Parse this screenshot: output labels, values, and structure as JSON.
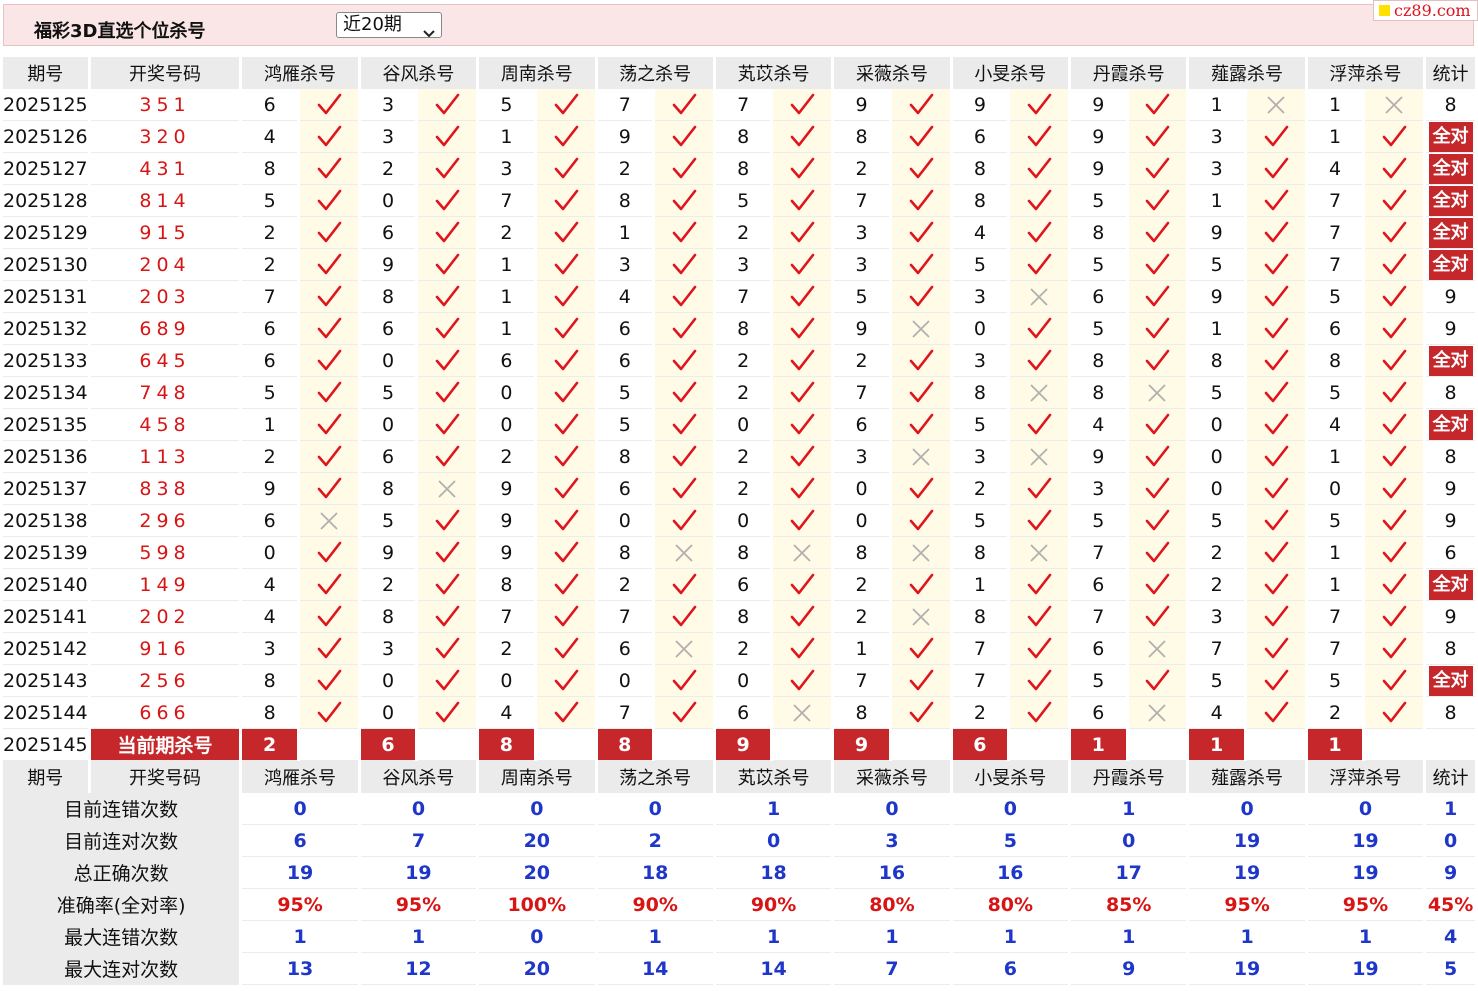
{
  "header": {
    "title": "福彩3D直选个位杀号",
    "period_select": "近20期",
    "watermark": "cz89.com"
  },
  "columns": {
    "period": "期号",
    "draw": "开奖号码",
    "experts": [
      "鸿雁杀号",
      "谷风杀号",
      "周南杀号",
      "荡之杀号",
      "芄苡杀号",
      "采薇杀号",
      "小旻杀号",
      "丹霞杀号",
      "薤露杀号",
      "浮萍杀号"
    ],
    "stats": "统计"
  },
  "all_right_label": "全对",
  "rows": [
    {
      "period": "2025125",
      "draw": "351",
      "kills": [
        [
          6,
          1
        ],
        [
          3,
          1
        ],
        [
          5,
          1
        ],
        [
          7,
          1
        ],
        [
          7,
          1
        ],
        [
          9,
          1
        ],
        [
          9,
          1
        ],
        [
          9,
          1
        ],
        [
          1,
          0
        ],
        [
          1,
          0
        ]
      ],
      "stat": "8"
    },
    {
      "period": "2025126",
      "draw": "320",
      "kills": [
        [
          4,
          1
        ],
        [
          3,
          1
        ],
        [
          1,
          1
        ],
        [
          9,
          1
        ],
        [
          8,
          1
        ],
        [
          8,
          1
        ],
        [
          6,
          1
        ],
        [
          9,
          1
        ],
        [
          3,
          1
        ],
        [
          1,
          1
        ]
      ],
      "stat": "全对"
    },
    {
      "period": "2025127",
      "draw": "431",
      "kills": [
        [
          8,
          1
        ],
        [
          2,
          1
        ],
        [
          3,
          1
        ],
        [
          2,
          1
        ],
        [
          8,
          1
        ],
        [
          2,
          1
        ],
        [
          8,
          1
        ],
        [
          9,
          1
        ],
        [
          3,
          1
        ],
        [
          4,
          1
        ]
      ],
      "stat": "全对"
    },
    {
      "period": "2025128",
      "draw": "814",
      "kills": [
        [
          5,
          1
        ],
        [
          0,
          1
        ],
        [
          7,
          1
        ],
        [
          8,
          1
        ],
        [
          5,
          1
        ],
        [
          7,
          1
        ],
        [
          8,
          1
        ],
        [
          5,
          1
        ],
        [
          1,
          1
        ],
        [
          7,
          1
        ]
      ],
      "stat": "全对"
    },
    {
      "period": "2025129",
      "draw": "915",
      "kills": [
        [
          2,
          1
        ],
        [
          6,
          1
        ],
        [
          2,
          1
        ],
        [
          1,
          1
        ],
        [
          2,
          1
        ],
        [
          3,
          1
        ],
        [
          4,
          1
        ],
        [
          8,
          1
        ],
        [
          9,
          1
        ],
        [
          7,
          1
        ]
      ],
      "stat": "全对"
    },
    {
      "period": "2025130",
      "draw": "204",
      "kills": [
        [
          2,
          1
        ],
        [
          9,
          1
        ],
        [
          1,
          1
        ],
        [
          3,
          1
        ],
        [
          3,
          1
        ],
        [
          3,
          1
        ],
        [
          5,
          1
        ],
        [
          5,
          1
        ],
        [
          5,
          1
        ],
        [
          7,
          1
        ]
      ],
      "stat": "全对"
    },
    {
      "period": "2025131",
      "draw": "203",
      "kills": [
        [
          7,
          1
        ],
        [
          8,
          1
        ],
        [
          1,
          1
        ],
        [
          4,
          1
        ],
        [
          7,
          1
        ],
        [
          5,
          1
        ],
        [
          3,
          0
        ],
        [
          6,
          1
        ],
        [
          9,
          1
        ],
        [
          5,
          1
        ]
      ],
      "stat": "9"
    },
    {
      "period": "2025132",
      "draw": "689",
      "kills": [
        [
          6,
          1
        ],
        [
          6,
          1
        ],
        [
          1,
          1
        ],
        [
          6,
          1
        ],
        [
          8,
          1
        ],
        [
          9,
          0
        ],
        [
          0,
          1
        ],
        [
          5,
          1
        ],
        [
          1,
          1
        ],
        [
          6,
          1
        ]
      ],
      "stat": "9"
    },
    {
      "period": "2025133",
      "draw": "645",
      "kills": [
        [
          6,
          1
        ],
        [
          0,
          1
        ],
        [
          6,
          1
        ],
        [
          6,
          1
        ],
        [
          2,
          1
        ],
        [
          2,
          1
        ],
        [
          3,
          1
        ],
        [
          8,
          1
        ],
        [
          8,
          1
        ],
        [
          8,
          1
        ]
      ],
      "stat": "全对"
    },
    {
      "period": "2025134",
      "draw": "748",
      "kills": [
        [
          5,
          1
        ],
        [
          5,
          1
        ],
        [
          0,
          1
        ],
        [
          5,
          1
        ],
        [
          2,
          1
        ],
        [
          7,
          1
        ],
        [
          8,
          0
        ],
        [
          8,
          0
        ],
        [
          5,
          1
        ],
        [
          5,
          1
        ]
      ],
      "stat": "8"
    },
    {
      "period": "2025135",
      "draw": "458",
      "kills": [
        [
          1,
          1
        ],
        [
          0,
          1
        ],
        [
          0,
          1
        ],
        [
          5,
          1
        ],
        [
          0,
          1
        ],
        [
          6,
          1
        ],
        [
          5,
          1
        ],
        [
          4,
          1
        ],
        [
          0,
          1
        ],
        [
          4,
          1
        ]
      ],
      "stat": "全对"
    },
    {
      "period": "2025136",
      "draw": "113",
      "kills": [
        [
          2,
          1
        ],
        [
          6,
          1
        ],
        [
          2,
          1
        ],
        [
          8,
          1
        ],
        [
          2,
          1
        ],
        [
          3,
          0
        ],
        [
          3,
          0
        ],
        [
          9,
          1
        ],
        [
          0,
          1
        ],
        [
          1,
          1
        ]
      ],
      "stat": "8"
    },
    {
      "period": "2025137",
      "draw": "838",
      "kills": [
        [
          9,
          1
        ],
        [
          8,
          0
        ],
        [
          9,
          1
        ],
        [
          6,
          1
        ],
        [
          2,
          1
        ],
        [
          0,
          1
        ],
        [
          2,
          1
        ],
        [
          3,
          1
        ],
        [
          0,
          1
        ],
        [
          0,
          1
        ]
      ],
      "stat": "9"
    },
    {
      "period": "2025138",
      "draw": "296",
      "kills": [
        [
          6,
          0
        ],
        [
          5,
          1
        ],
        [
          9,
          1
        ],
        [
          0,
          1
        ],
        [
          0,
          1
        ],
        [
          0,
          1
        ],
        [
          5,
          1
        ],
        [
          5,
          1
        ],
        [
          5,
          1
        ],
        [
          5,
          1
        ]
      ],
      "stat": "9"
    },
    {
      "period": "2025139",
      "draw": "598",
      "kills": [
        [
          0,
          1
        ],
        [
          9,
          1
        ],
        [
          9,
          1
        ],
        [
          8,
          0
        ],
        [
          8,
          0
        ],
        [
          8,
          0
        ],
        [
          8,
          0
        ],
        [
          7,
          1
        ],
        [
          2,
          1
        ],
        [
          1,
          1
        ]
      ],
      "stat": "6"
    },
    {
      "period": "2025140",
      "draw": "149",
      "kills": [
        [
          4,
          1
        ],
        [
          2,
          1
        ],
        [
          8,
          1
        ],
        [
          2,
          1
        ],
        [
          6,
          1
        ],
        [
          2,
          1
        ],
        [
          1,
          1
        ],
        [
          6,
          1
        ],
        [
          2,
          1
        ],
        [
          1,
          1
        ]
      ],
      "stat": "全对"
    },
    {
      "period": "2025141",
      "draw": "202",
      "kills": [
        [
          4,
          1
        ],
        [
          8,
          1
        ],
        [
          7,
          1
        ],
        [
          7,
          1
        ],
        [
          8,
          1
        ],
        [
          2,
          0
        ],
        [
          8,
          1
        ],
        [
          7,
          1
        ],
        [
          3,
          1
        ],
        [
          7,
          1
        ]
      ],
      "stat": "9"
    },
    {
      "period": "2025142",
      "draw": "916",
      "kills": [
        [
          3,
          1
        ],
        [
          3,
          1
        ],
        [
          2,
          1
        ],
        [
          6,
          0
        ],
        [
          2,
          1
        ],
        [
          1,
          1
        ],
        [
          7,
          1
        ],
        [
          6,
          0
        ],
        [
          7,
          1
        ],
        [
          7,
          1
        ]
      ],
      "stat": "8"
    },
    {
      "period": "2025143",
      "draw": "256",
      "kills": [
        [
          8,
          1
        ],
        [
          0,
          1
        ],
        [
          0,
          1
        ],
        [
          0,
          1
        ],
        [
          0,
          1
        ],
        [
          7,
          1
        ],
        [
          7,
          1
        ],
        [
          5,
          1
        ],
        [
          5,
          1
        ],
        [
          5,
          1
        ]
      ],
      "stat": "全对"
    },
    {
      "period": "2025144",
      "draw": "666",
      "kills": [
        [
          8,
          1
        ],
        [
          0,
          1
        ],
        [
          4,
          1
        ],
        [
          7,
          1
        ],
        [
          6,
          0
        ],
        [
          8,
          1
        ],
        [
          2,
          1
        ],
        [
          6,
          0
        ],
        [
          4,
          1
        ],
        [
          2,
          1
        ]
      ],
      "stat": "8"
    }
  ],
  "current": {
    "period": "2025145",
    "label": "当前期杀号",
    "kills": [
      "2",
      "6",
      "8",
      "8",
      "9",
      "9",
      "6",
      "1",
      "1",
      "1"
    ]
  },
  "summary": [
    {
      "label": "目前连错次数",
      "values": [
        "0",
        "0",
        "0",
        "0",
        "1",
        "0",
        "0",
        "1",
        "0",
        "0",
        "1"
      ],
      "kind": "val"
    },
    {
      "label": "目前连对次数",
      "values": [
        "6",
        "7",
        "20",
        "2",
        "0",
        "3",
        "5",
        "0",
        "19",
        "19",
        "0"
      ],
      "kind": "val"
    },
    {
      "label": "总正确次数",
      "values": [
        "19",
        "19",
        "20",
        "18",
        "18",
        "16",
        "16",
        "17",
        "19",
        "19",
        "9"
      ],
      "kind": "val"
    },
    {
      "label": "准确率(全对率)",
      "values": [
        "95%",
        "95%",
        "100%",
        "90%",
        "90%",
        "80%",
        "80%",
        "85%",
        "95%",
        "95%",
        "45%"
      ],
      "kind": "pct"
    },
    {
      "label": "最大连错次数",
      "values": [
        "1",
        "1",
        "0",
        "1",
        "1",
        "1",
        "1",
        "1",
        "1",
        "1",
        "4"
      ],
      "kind": "val"
    },
    {
      "label": "最大连对次数",
      "values": [
        "13",
        "12",
        "20",
        "14",
        "14",
        "7",
        "6",
        "9",
        "19",
        "19",
        "5"
      ],
      "kind": "val"
    }
  ],
  "colors": {
    "accent_red": "#c6272b",
    "stat_blue": "#1e37c8",
    "check_red": "#e0141c",
    "cross_gray": "#b0b0b0",
    "mark_bg": "#fffbe6"
  },
  "icons": {
    "correct": "check-icon",
    "wrong": "cross-icon"
  }
}
